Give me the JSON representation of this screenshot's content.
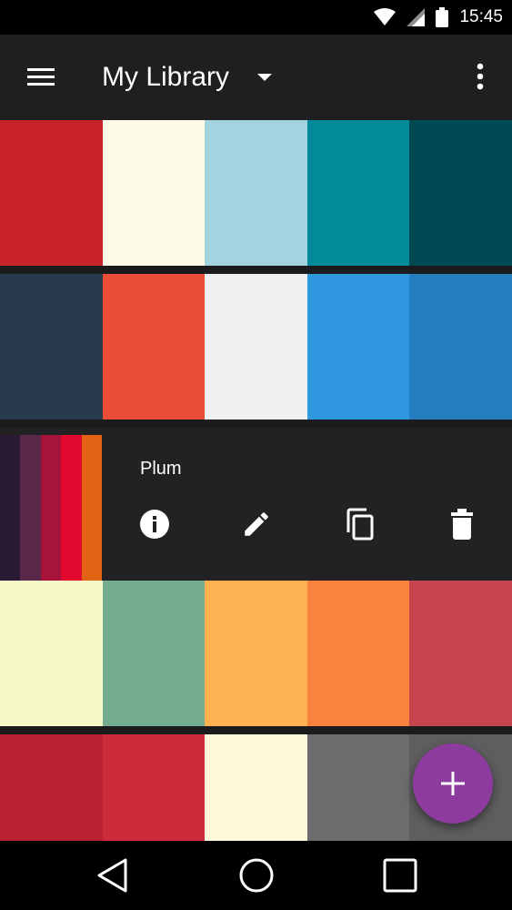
{
  "status_bar": {
    "time": "15:45"
  },
  "app_bar": {
    "title": "My Library"
  },
  "themes": [
    {
      "colors": [
        "#c8222b",
        "#fdfae8",
        "#a2d3de",
        "#028a9b",
        "#004a53"
      ]
    },
    {
      "colors": [
        "#293a4d",
        "#ea4e36",
        "#eef0f2",
        "#2f98e0",
        "#247fc0"
      ]
    },
    {
      "name": "Plum",
      "selected": true,
      "colors": [
        "#2a1a35",
        "#5a2848",
        "#a8133b",
        "#e2082e",
        "#e36315"
      ]
    },
    {
      "colors": [
        "#f4f9c7",
        "#74aa8d",
        "#fdb150",
        "#fa813e",
        "#c7454e"
      ]
    },
    {
      "colors": [
        "#b8212f",
        "#cc2b3a",
        "#fdf8d8",
        "#6c6c6e",
        "#5e5e60"
      ]
    }
  ],
  "selected_theme": {
    "name": "Plum"
  },
  "icons": {
    "menu": "hamburger-icon",
    "dropdown": "triangle-down-icon",
    "overflow": "vertical-dots-icon",
    "info": "info-icon",
    "edit": "pencil-icon",
    "copy": "copy-icon",
    "delete": "trash-icon",
    "add": "plus-icon"
  },
  "colors": {
    "fab": "#8e3ba0",
    "app_bar": "#1f1f21",
    "background": "#1b1b1d"
  }
}
